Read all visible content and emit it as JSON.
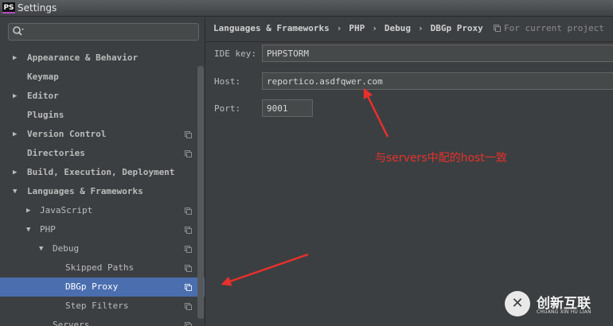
{
  "window": {
    "title": "Settings",
    "app_logo": "PS"
  },
  "search": {
    "placeholder": "",
    "icon": "search-icon"
  },
  "tree": [
    {
      "id": "appearance",
      "label": "Appearance & Behavior",
      "level": 0,
      "arrow": "right",
      "copy": false,
      "selected": false
    },
    {
      "id": "keymap",
      "label": "Keymap",
      "level": 0,
      "arrow": "",
      "copy": false,
      "selected": false
    },
    {
      "id": "editor",
      "label": "Editor",
      "level": 0,
      "arrow": "right",
      "copy": false,
      "selected": false
    },
    {
      "id": "plugins",
      "label": "Plugins",
      "level": 0,
      "arrow": "",
      "copy": false,
      "selected": false
    },
    {
      "id": "version-control",
      "label": "Version Control",
      "level": 0,
      "arrow": "right",
      "copy": true,
      "selected": false
    },
    {
      "id": "directories",
      "label": "Directories",
      "level": 0,
      "arrow": "",
      "copy": true,
      "selected": false
    },
    {
      "id": "build",
      "label": "Build, Execution, Deployment",
      "level": 0,
      "arrow": "right",
      "copy": false,
      "selected": false
    },
    {
      "id": "languages",
      "label": "Languages & Frameworks",
      "level": 0,
      "arrow": "down",
      "copy": false,
      "selected": false
    },
    {
      "id": "javascript",
      "label": "JavaScript",
      "level": 1,
      "arrow": "right",
      "copy": true,
      "selected": false
    },
    {
      "id": "php",
      "label": "PHP",
      "level": 1,
      "arrow": "down",
      "copy": true,
      "selected": false
    },
    {
      "id": "debug",
      "label": "Debug",
      "level": 2,
      "arrow": "down",
      "copy": true,
      "selected": false
    },
    {
      "id": "skipped-paths",
      "label": "Skipped Paths",
      "level": 3,
      "arrow": "",
      "copy": true,
      "selected": false
    },
    {
      "id": "dbgp-proxy",
      "label": "DBGp Proxy",
      "level": 3,
      "arrow": "",
      "copy": true,
      "selected": true
    },
    {
      "id": "step-filters",
      "label": "Step Filters",
      "level": 3,
      "arrow": "",
      "copy": true,
      "selected": false
    },
    {
      "id": "servers",
      "label": "Servers",
      "level": 2,
      "arrow": "",
      "copy": true,
      "selected": false
    }
  ],
  "breadcrumb": {
    "items": [
      "Languages & Frameworks",
      "PHP",
      "Debug",
      "DBGp Proxy"
    ],
    "separator": "›"
  },
  "for_current_project": "For current project",
  "form": {
    "ide_key": {
      "label": "IDE key:",
      "value": "PHPSTORM"
    },
    "host": {
      "label": "Host:",
      "value": "reportico.asdfqwer.com"
    },
    "port": {
      "label": "Port:",
      "value": "9001"
    }
  },
  "annotation": {
    "text": "与servers中配的host一致",
    "color": "#e8302c"
  },
  "watermark": {
    "cn": "创新互联",
    "en": "CHUANG XIN HU LIAN",
    "logo_glyph": "✕"
  },
  "colors": {
    "selection": "#4b6eaf",
    "background": "#3c3f41",
    "annotation": "#e8302c"
  }
}
